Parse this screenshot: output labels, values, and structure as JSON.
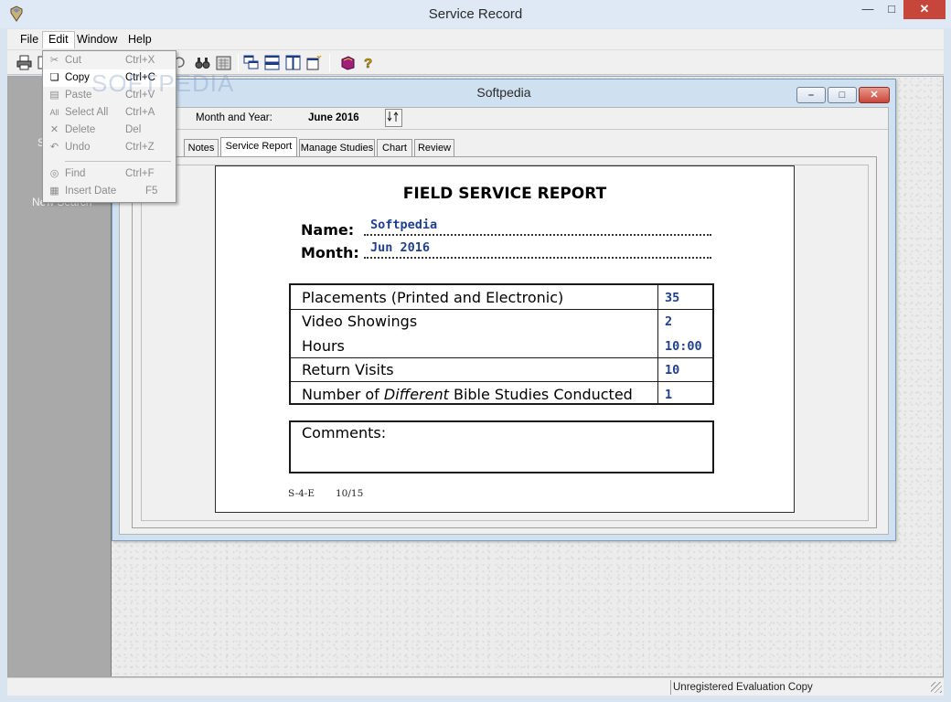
{
  "app": {
    "title": "Service Record"
  },
  "menu": {
    "file": "File",
    "edit": "Edit",
    "window": "Window",
    "help": "Help"
  },
  "edit_menu": {
    "items": [
      {
        "label": "Cut",
        "shortcut": "Ctrl+X",
        "enabled": false
      },
      {
        "label": "Copy",
        "shortcut": "Ctrl+C",
        "enabled": true
      },
      {
        "label": "Paste",
        "shortcut": "Ctrl+V",
        "enabled": false
      },
      {
        "label": "Select All",
        "shortcut": "Ctrl+A",
        "enabled": false
      },
      {
        "label": "Delete",
        "shortcut": "Del",
        "enabled": false
      },
      {
        "label": "Undo",
        "shortcut": "Ctrl+Z",
        "enabled": false
      },
      {
        "label": "Find",
        "shortcut": "Ctrl+F",
        "enabled": false
      },
      {
        "label": "Insert Date",
        "shortcut": "F5",
        "enabled": false
      }
    ]
  },
  "left_panel": {
    "partial_s": "S",
    "partial_new": "New Search"
  },
  "watermark": "SOFTPEDIA",
  "child": {
    "title": "Softpedia",
    "month_label": "Month and Year:",
    "month_value": "June 2016",
    "tabs": [
      "Notes",
      "Service Report",
      "Manage Studies",
      "Chart",
      "Review"
    ],
    "active_tab": "Service Report"
  },
  "report": {
    "title": "FIELD SERVICE REPORT",
    "name_label": "Name:",
    "name_value": "Softpedia",
    "month_label": "Month:",
    "month_value": "Jun 2016",
    "rows": [
      {
        "label": "Placements (Printed and Electronic)",
        "value": "35"
      },
      {
        "label": "Video Showings",
        "value": "2"
      },
      {
        "label": "Hours",
        "value": "10:00"
      },
      {
        "label": "Return Visits",
        "value": "10"
      },
      {
        "label_pre": "Number of ",
        "label_em": "Different",
        "label_post": " Bible Studies Conducted",
        "value": "1"
      }
    ],
    "comments_label": "Comments:",
    "form_code": "S-4-E",
    "form_date": "10/15"
  },
  "status": {
    "text": "Unregistered Evaluation Copy"
  },
  "colors": {
    "value_blue": "#1f3f8f",
    "close_red": "#c7463b",
    "title_bar": "#dfe8f5"
  }
}
